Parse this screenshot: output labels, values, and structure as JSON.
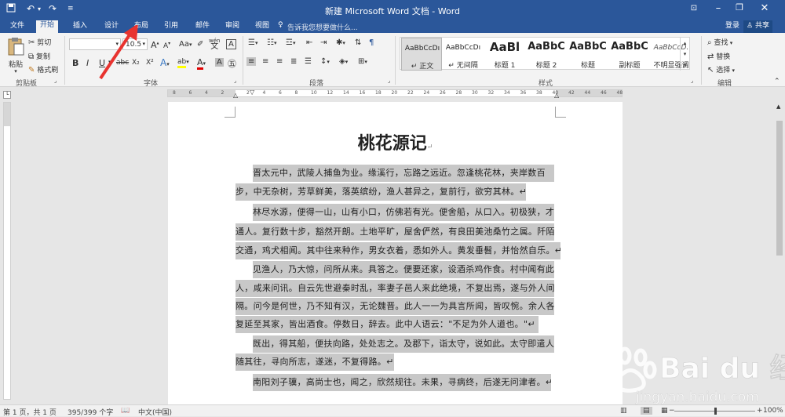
{
  "window": {
    "title": "新建 Microsoft Word 文档 - Word"
  },
  "tabs": [
    {
      "label": "文件"
    },
    {
      "label": "开始"
    },
    {
      "label": "插入"
    },
    {
      "label": "设计"
    },
    {
      "label": "布局"
    },
    {
      "label": "引用"
    },
    {
      "label": "邮件"
    },
    {
      "label": "审阅"
    },
    {
      "label": "视图"
    }
  ],
  "tell_me": "告诉我您想要做什么...",
  "account": {
    "login": "登录",
    "share": "共享"
  },
  "clipboard": {
    "paste": "粘贴",
    "cut": "剪切",
    "copy": "复制",
    "format_painter": "格式刷",
    "group": "剪贴板"
  },
  "font": {
    "size": "10.5",
    "group": "字体",
    "bold": "B",
    "italic": "I",
    "underline": "U",
    "strike": "abc",
    "subscript": "X₂",
    "superscript": "X²",
    "grow": "A",
    "shrink": "A",
    "case": "Aa",
    "wen": "wén",
    "border_a": "A",
    "color_a": "A",
    "highlight": "ab",
    "shade_a": "A",
    "effects_a": "A"
  },
  "paragraph": {
    "group": "段落"
  },
  "styles": {
    "group": "样式",
    "items": [
      {
        "sample": "AaBbCcDı",
        "name": "↵ 正文"
      },
      {
        "sample": "AaBbCcDı",
        "name": "↵ 无间隔"
      },
      {
        "sample": "AaBl",
        "name": "标题 1"
      },
      {
        "sample": "AaBbC",
        "name": "标题 2"
      },
      {
        "sample": "AaBbC",
        "name": "标题"
      },
      {
        "sample": "AaBbC",
        "name": "副标题"
      },
      {
        "sample": "AaBbCcD.",
        "name": "不明显强调"
      }
    ]
  },
  "editing": {
    "find": "查找",
    "replace": "替换",
    "select": "选择",
    "group": "编辑"
  },
  "ruler": {
    "marks": [
      "8",
      "6",
      "4",
      "2",
      "2",
      "4",
      "6",
      "8",
      "10",
      "12",
      "14",
      "16",
      "18",
      "20",
      "22",
      "24",
      "26",
      "28",
      "30",
      "32",
      "34",
      "36",
      "38",
      "40",
      "42",
      "44",
      "46",
      "48"
    ]
  },
  "document": {
    "title": "桃花源记",
    "title_mark": "↵",
    "lines": [
      "晋太元中，武陵人捕鱼为业。缘溪行，忘路之远近。忽逢桃花林，夹岸数百",
      "步，中无杂树，芳草鲜美，落英缤纷，渔人甚异之，复前行，欲穷其林。↵",
      "林尽水源，便得一山，山有小口，仿佛若有光。便舍船，从口入。初极狭，才",
      "通人。复行数十步，豁然开朗。土地平旷，屋舍俨然，有良田美池桑竹之属。阡陌",
      "交通，鸡犬相闻。其中往来种作，男女衣着，悉如外人。黄发垂髫，并怡然自乐。↵",
      "见渔人，乃大惊，问所从来。具答之。便要还家，设酒杀鸡作食。村中闻有此",
      "人，咸来问讯。自云先世避秦时乱，率妻子邑人来此绝境，不复出焉，遂与外人间",
      "隔。问今是何世，乃不知有汉，无论魏晋。此人一一为具言所闻，皆叹惋。余人各",
      "复延至其家，皆出酒食。停数日，辞去。此中人语云：\"不足为外人道也。\"↵",
      "既出，得其船，便扶向路，处处志之。及郡下，诣太守，说如此。太守即遣人",
      "随其往，寻向所志，遂迷，不复得路。↵",
      "南阳刘子骥，高尚士也，闻之，欣然规往。未果，寻病终，后遂无问津者。↵"
    ]
  },
  "statusbar": {
    "page": "第 1 页，共 1 页",
    "words": "395/399 个字",
    "language": "中文(中国)",
    "zoom": "100%",
    "minus": "−",
    "plus": "+"
  },
  "watermark": {
    "brand": "Bai du 经验",
    "url": "jingyan.baidu.com"
  },
  "colors": {
    "title_bar": "#2b579a",
    "selection": "#c8c8c8",
    "arrow": "#e8332f"
  }
}
